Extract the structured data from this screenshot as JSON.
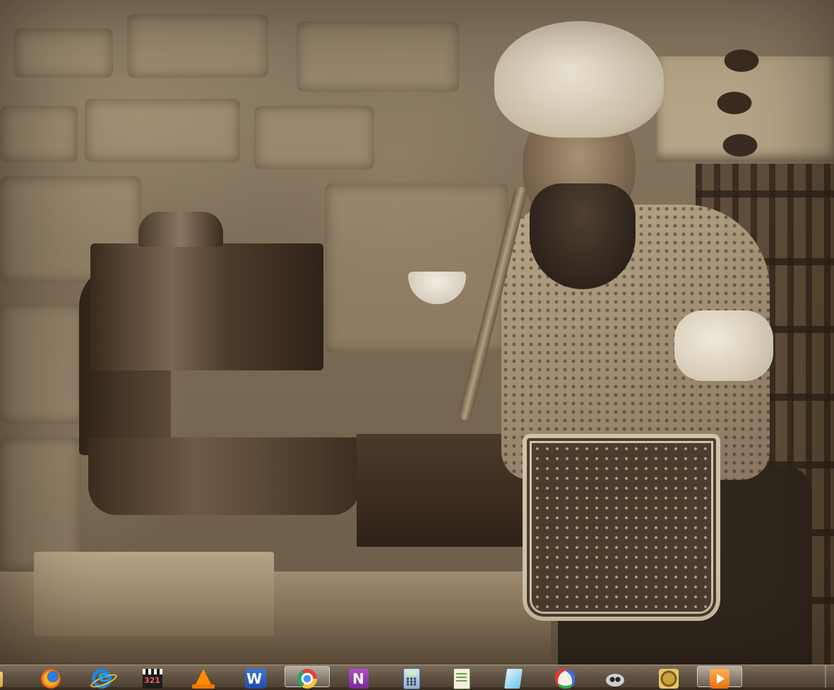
{
  "desktop": {
    "wallpaper": "sepia-photograph"
  },
  "taskbar": {
    "items": [
      {
        "icon": "folder-icon"
      },
      {
        "icon": "firefox-icon"
      },
      {
        "icon": "internet-explorer-icon"
      },
      {
        "icon": "media-player-classic-icon",
        "text": "321"
      },
      {
        "icon": "vlc-icon"
      },
      {
        "icon": "word-icon",
        "text": "W"
      },
      {
        "icon": "chrome-icon",
        "active": true
      },
      {
        "icon": "onenote-icon",
        "text": "N"
      },
      {
        "icon": "calculator-icon"
      },
      {
        "icon": "notepad-icon"
      },
      {
        "icon": "pen-icon"
      },
      {
        "icon": "paint-icon"
      },
      {
        "icon": "bug-icon"
      },
      {
        "icon": "quran-icon"
      },
      {
        "icon": "media-player-icon",
        "active": true
      }
    ],
    "colors": {
      "bar": "#5e5040",
      "highlight": "#ffffff"
    }
  }
}
